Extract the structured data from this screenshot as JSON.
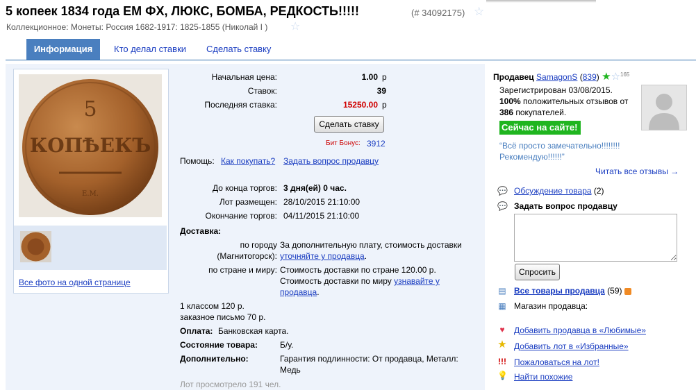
{
  "header": {
    "title": "5 копеек 1834 года ЕМ ФХ, ЛЮКС, БОМБА, РЕДКОСТЬ!!!!!",
    "lot_number": "(# 34092175)",
    "breadcrumb": "Коллекционное: Монеты: Россия 1682-1917: 1825-1855 (Николай I )"
  },
  "tabs": [
    "Информация",
    "Кто делал ставки",
    "Сделать ставку"
  ],
  "gallery": {
    "all_photos": "Все фото на одной странице"
  },
  "auction": {
    "start_price_label": "Начальная цена:",
    "start_price": "1.00",
    "bids_label": "Ставок:",
    "bids": "39",
    "last_bid_label": "Последняя ставка:",
    "last_bid": "15250.00",
    "currency": "р",
    "bid_button": "Сделать ставку",
    "bit_bonus_label": "Бит Бонус:",
    "bit_bonus": "3912",
    "help_label": "Помощь:",
    "help_how": "Как покупать?",
    "help_ask": "Задать вопрос продавцу",
    "remaining_label": "До конца торгов:",
    "remaining": "3 дня(ей) 0 час.",
    "placed_label": "Лот размещен:",
    "placed": "28/10/2015 21:10:00",
    "end_label": "Окончание торгов:",
    "end": "04/11/2015 21:10:00",
    "delivery_label": "Доставка:",
    "city_label_1": "по городу",
    "city_label_2": "(Магнитогорск):",
    "city_text": "За дополнительную плату, стоимость доставки",
    "city_link": "уточняйте у продавца",
    "country_label": "по стране и миру:",
    "country_text_1": "Стоимость доставки по стране 120.00 р.",
    "country_text_2": "Стоимость доставки по миру",
    "country_link_1": "узнавайте у",
    "country_link_2": "продавца",
    "extra_1": "1 классом 120 р.",
    "extra_2": "заказное письмо 70 р.",
    "payment_label": "Оплата:",
    "payment": "Банковская карта.",
    "condition_label": "Состояние товара:",
    "condition": "Б/у.",
    "additional_label": "Дополнительно:",
    "additional_1": "Гарантия подлинности: От продавца, Металл:",
    "additional_2": "Медь",
    "views": "Лот просмотрело 191 чел."
  },
  "seller": {
    "label": "Продавец",
    "name": "SamagonS",
    "rating": "839",
    "stars_count": "165",
    "registered": "Зарегистрирован 03/08/2015.",
    "positive_pct": "100%",
    "positive_text": "положительных отзывов от",
    "buyers": "386",
    "buyers_text": "покупателей.",
    "online": "Сейчас на сайте!",
    "review_1": "“Всё просто замечательно!!!!!!!!",
    "review_2": "Рекомендую!!!!!!”",
    "read_all": "Читать все отзывы →"
  },
  "sidebar": {
    "discussion": "Обсуждение товара",
    "discussion_count": "(2)",
    "ask_title": "Задать вопрос продавцу",
    "ask_button": "Спросить",
    "all_items": "Все товары продавца",
    "all_items_count": "(59)",
    "shop": "Магазин продавца:",
    "fav_seller": "Добавить продавца в «Любимые»",
    "fav_lot": "Добавить лот в «Избранные»",
    "complain": "Пожаловаться на лот!",
    "similar": "Найти похожие"
  },
  "colors": {
    "accent": "#4a7fbf",
    "link": "#1a3dc1",
    "price_red": "#d00000",
    "online_green": "#1fb51f",
    "panel": "#eef3fb"
  }
}
